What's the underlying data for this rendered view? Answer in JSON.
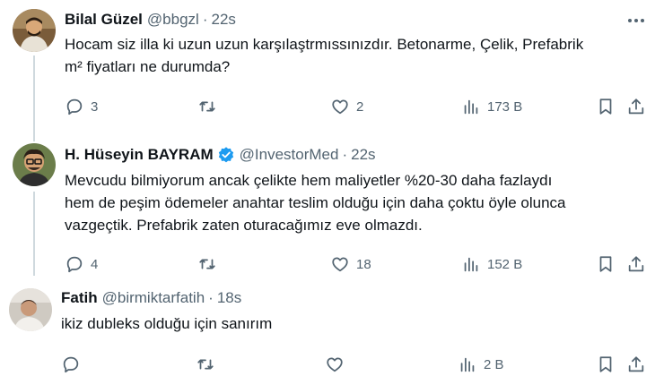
{
  "tweets": [
    {
      "name": "Bilal Güzel",
      "handle": "@bbgzl",
      "separator": "·",
      "time": "22s",
      "text": "Hocam siz illa ki uzun uzun karşılaştrmıssınızdır. Betonarme, Çelik, Prefabrik\nm² fiyatları ne durumda?",
      "replies": "3",
      "reposts": "",
      "likes": "2",
      "views": "173 B",
      "verified": false
    },
    {
      "name": "H. Hüseyin BAYRAM",
      "handle": "@InvestorMed",
      "separator": "·",
      "time": "22s",
      "text": "Mevcudu bilmiyorum ancak çelikte hem maliyetler %20-30 daha fazlaydı\nhem de peşim ödemeler anahtar teslim olduğu için daha çoktu öyle olunca\nvazgeçtik. Prefabrik zaten oturacağımız eve olmazdı.",
      "replies": "4",
      "reposts": "",
      "likes": "18",
      "views": "152 B",
      "verified": true
    },
    {
      "name": "Fatih",
      "handle": "@birmiktarfatih",
      "separator": "·",
      "time": "18s",
      "text": "ikiz dubleks olduğu için sanırım",
      "replies": "",
      "reposts": "",
      "likes": "",
      "views": "2 B",
      "verified": false
    }
  ],
  "colors": {
    "text": "#0f1419",
    "secondary": "#536471",
    "verified": "#1d9bf0",
    "thread_line": "#cfd9de"
  },
  "icons": [
    "reply-icon",
    "repost-icon",
    "like-icon",
    "views-icon",
    "bookmark-icon",
    "share-icon",
    "more-icon",
    "verified-badge-icon"
  ]
}
